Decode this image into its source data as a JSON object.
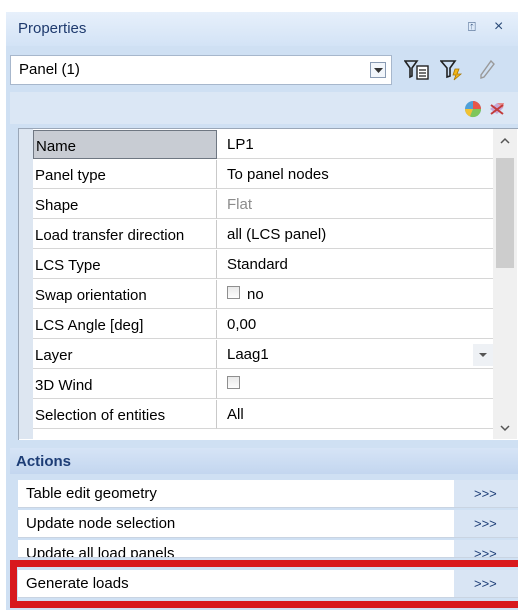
{
  "panel": {
    "title": "Properties",
    "pin_glyph": "⍐",
    "close_glyph": "×"
  },
  "selector": {
    "value": "Panel (1)"
  },
  "icons": {
    "filter_select": "filter-select-icon",
    "filter_add": "filter-add-icon",
    "pencil": "pencil-icon",
    "pie": "pie-chart-icon",
    "eraser": "eraser-icon"
  },
  "properties": [
    {
      "name": "Name",
      "value": "LP1"
    },
    {
      "name": "Panel type",
      "value": "To panel nodes"
    },
    {
      "name": "Shape",
      "value": "Flat"
    },
    {
      "name": "Load transfer direction",
      "value": "all (LCS panel)"
    },
    {
      "name": "LCS Type",
      "value": "Standard"
    },
    {
      "name": "Swap orientation",
      "value": "no"
    },
    {
      "name": "LCS Angle [deg]",
      "value": "0,00"
    },
    {
      "name": "Layer",
      "value": "Laag1"
    },
    {
      "name": "3D Wind",
      "value": ""
    },
    {
      "name": "Selection of entities",
      "value": "All"
    }
  ],
  "actions": {
    "title": "Actions",
    "items": [
      {
        "label": "Table edit geometry",
        "button": ">>>"
      },
      {
        "label": "Update node selection",
        "button": ">>>"
      },
      {
        "label": "Update all load panels",
        "button": ">>>"
      },
      {
        "label": "Generate loads",
        "button": ">>>"
      }
    ]
  },
  "colors": {
    "title_text": "#1e3a6e",
    "highlight": "#d8181d",
    "selected_cell": "#c8ccd3"
  }
}
